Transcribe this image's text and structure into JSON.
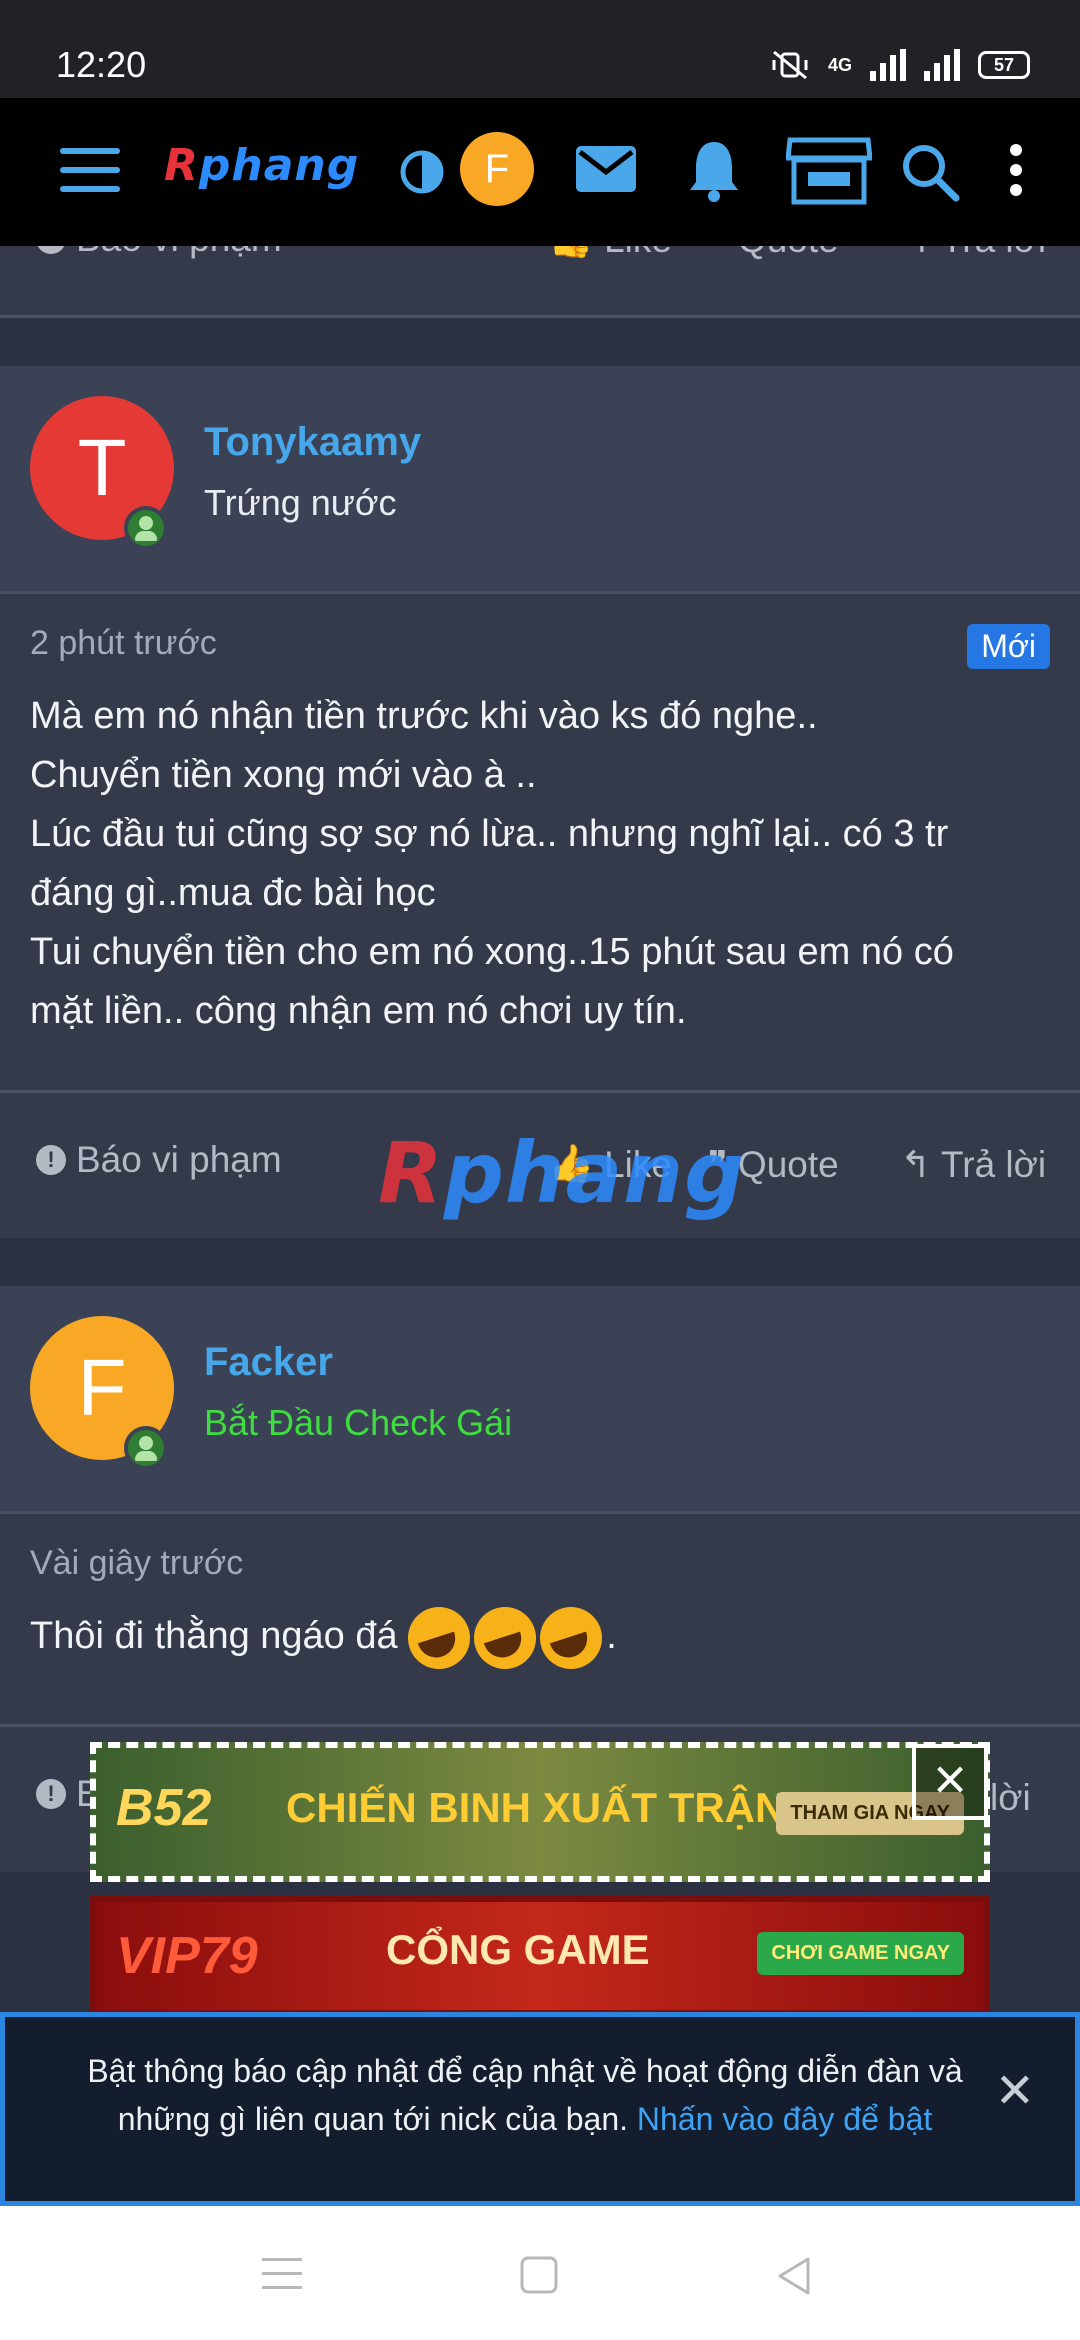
{
  "status_bar": {
    "time": "12:20",
    "network": "4G",
    "battery": "57"
  },
  "topnav": {
    "logo_r": "R",
    "logo_rest": "phang",
    "avatar_letter": "F",
    "icons": [
      "menu-icon",
      "contrast-icon",
      "mail-icon",
      "bell-icon",
      "store-icon",
      "search-icon",
      "more-vertical-icon"
    ]
  },
  "prev_footer": {
    "report": "Báo vi phạm",
    "like": "Like",
    "quote": "Quote",
    "reply": "Trả lời"
  },
  "posts": [
    {
      "avatar_letter": "T",
      "avatar_color": "#e53935",
      "username": "Tonykaamy",
      "user_title": "Trứng nước",
      "time": "2 phút trước",
      "badge": "Mới",
      "lines": [
        "Mà em nó nhận tiền trước khi vào ks đó nghe..",
        "Chuyển tiền xong mới vào à ..",
        "Lúc đầu tui cũng sợ sợ nó lừa.. nhưng nghĩ lại.. có 3 tr",
        "đáng gì..mua đc bài học",
        "Tui chuyển tiền cho em nó xong..15 phút sau em nó có",
        "mặt liền.. công nhận em nó chơi uy tín."
      ],
      "footer": {
        "report": "Báo vi phạm",
        "like": "Like",
        "quote": "Quote",
        "reply": "Trả lời"
      }
    },
    {
      "avatar_letter": "F",
      "avatar_color": "#f9a825",
      "username": "Facker",
      "user_title": "Bắt Đầu Check Gái",
      "user_title_color": "#3fdc3f",
      "time": "Vài giây trước",
      "text": "Thôi đi thằng ngáo đá",
      "text_end": ".",
      "footer": {
        "report": "B",
        "reply": "lời"
      }
    }
  ],
  "watermark": {
    "r": "R",
    "rest": "phang"
  },
  "ads": [
    {
      "brand": "B52",
      "title": "CHIẾN BINH XUẤT TRẬN",
      "cta": "THAM GIA NGAY"
    },
    {
      "brand": "VIP79",
      "title": "CỔNG GAME",
      "cta": "CHƠI GAME NGAY"
    }
  ],
  "notification": {
    "text": "Bật thông báo cập nhật để cập nhật về hoạt động diễn đàn và những gì liên quan tới nick của bạn.",
    "link": "Nhấn vào đây để bật"
  },
  "android_nav": [
    "recents-icon",
    "home-icon",
    "back-icon"
  ]
}
